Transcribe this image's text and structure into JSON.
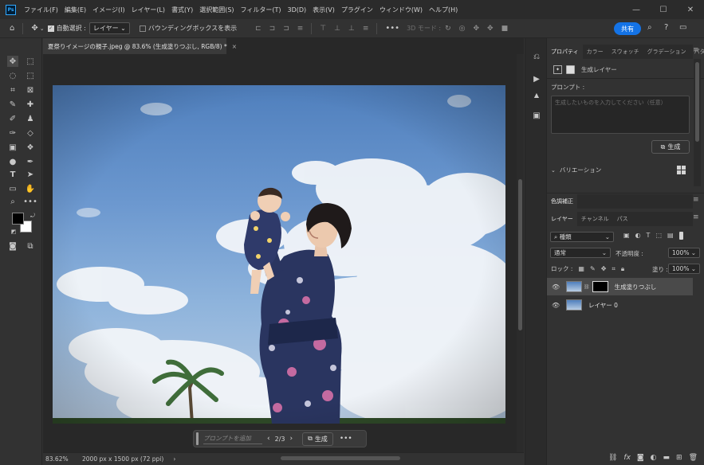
{
  "menu": [
    "ファイル(F)",
    "編集(E)",
    "イメージ(I)",
    "レイヤー(L)",
    "書式(Y)",
    "選択範囲(S)",
    "フィルター(T)",
    "3D(D)",
    "表示(V)",
    "プラグイン",
    "ウィンドウ(W)",
    "ヘルプ(H)"
  ],
  "window_controls": [
    "—",
    "☐",
    "✕"
  ],
  "options": {
    "auto_select_label": "自動選択 :",
    "auto_select_value": "レイヤー",
    "bounding_box_label": "バウンディングボックスを表示",
    "mode_3d_label": "3D モード :",
    "share_label": "共有"
  },
  "document": {
    "tab_title": "夏祭りイメージの親子.jpeg @ 83.6% (生成塗りつぶし, RGB/8) *",
    "zoom": "83.62%",
    "dimensions": "2000 px x 1500 px (72 ppi)"
  },
  "context_bar": {
    "prompt_placeholder": "プロンプトを追加",
    "page_indicator": "2/3",
    "generate_label": "生成",
    "prev": "‹",
    "next": "›",
    "more": "•••"
  },
  "properties_panel": {
    "tabs": [
      "プロパティ",
      "カラー",
      "スウォッチ",
      "グラデーション",
      "パターン"
    ],
    "layer_type": "生成レイヤー",
    "prompt_label": "プロンプト :",
    "prompt_placeholder": "生成したいものを入力してください（任意）",
    "generate_label": "生成",
    "variations_label": "バリエーション"
  },
  "adjustments_panel": {
    "tab": "色調補正"
  },
  "layers_panel": {
    "tabs": [
      "レイヤー",
      "チャンネル",
      "パス"
    ],
    "filter_value": "種類",
    "blend_mode": "通常",
    "opacity_label": "不透明度 :",
    "opacity_value": "100%",
    "lock_label": "ロック :",
    "fill_label": "塗り :",
    "fill_value": "100%",
    "layers": [
      {
        "name": "生成塗りつぶし",
        "selected": true,
        "has_mask": true
      },
      {
        "name": "レイヤー 0",
        "selected": false,
        "has_mask": false
      }
    ]
  },
  "colors": {
    "accent": "#1473e6",
    "foreground": "#000000",
    "background": "#ffffff"
  }
}
